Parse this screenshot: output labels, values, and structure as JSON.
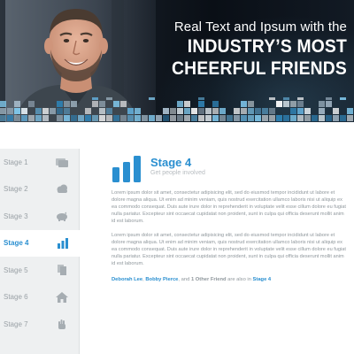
{
  "hero": {
    "line1": "Real Text and Ipsum with the",
    "line2": "INDUSTRY’S MOST",
    "line3": "CHEERFUL FRIENDS"
  },
  "sidebar": {
    "items": [
      {
        "label": "Stage 1",
        "icon": "cards-icon",
        "active": false
      },
      {
        "label": "Stage 2",
        "icon": "cloud-icon",
        "active": false
      },
      {
        "label": "Stage 3",
        "icon": "piggy-bank-icon",
        "active": false
      },
      {
        "label": "Stage 4",
        "icon": "bar-chart-icon",
        "active": true
      },
      {
        "label": "Stage 5",
        "icon": "documents-icon",
        "active": false
      },
      {
        "label": "Stage 6",
        "icon": "home-icon",
        "active": false
      },
      {
        "label": "Stage 7",
        "icon": "hand-icon",
        "active": false
      }
    ]
  },
  "main": {
    "icon": "bar-chart-icon",
    "title": "Stage 4",
    "subtitle": "Get people involved",
    "paragraph1": "Lorem ipsum dolor sit amet, consectetur adipisicing elit, sed do eiusmod tempor incididunt ut labore et dolore magna aliqua. Ut enim ad minim veniam, quis nostrud exercitation ullamco laboris nisi ut aliquip ex ea commodo consequat. Duis aute irure dolor in reprehenderit in voluptate velit esse cillum dolore eu fugiat nulla pariatur. Excepteur sint occaecat cupidatat non proident, sunt in culpa qui officia deserunt mollit anim id est laborum.",
    "paragraph2": "Lorem ipsum dolor sit amet, consectetur adipisicing elit, sed do eiusmod tempor incididunt ut labore et dolore magna aliqua. Ut enim ad minim veniam, quis nostrud exercitation ullamco laboris nisi ut aliquip ex ea commodo consequat. Duis aute irure dolor in reprehenderit in voluptate velit esse cillum dolore eu fugiat nulla pariatur. Excepteur sint occaecat cupidatat non proident, sunt in culpa qui officia deserunt mollit anim id est laborum.",
    "friends": {
      "name1": "Deborah Lee",
      "sep": ", ",
      "name2": "Bobby Pierce",
      "mid": ", and ",
      "others": "1 Other Friend",
      "tail": " are also in ",
      "stage": "Stage 4"
    }
  },
  "colors": {
    "accent": "#2a8fd0",
    "sidebar_bg": "#eef0f1",
    "hero_dark": "#0a0f16",
    "muted_text": "#9aa1a6"
  }
}
